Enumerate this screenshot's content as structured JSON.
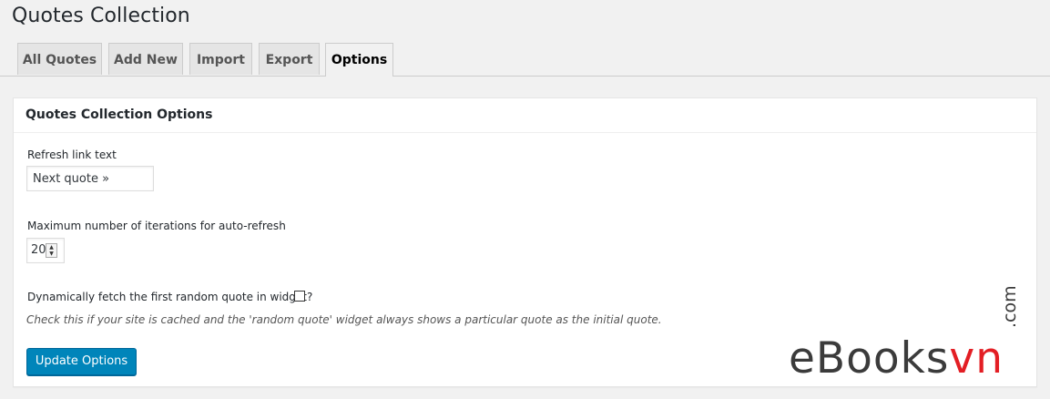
{
  "page": {
    "title": "Quotes Collection"
  },
  "tabs": [
    {
      "label": "All Quotes",
      "active": false
    },
    {
      "label": "Add New",
      "active": false
    },
    {
      "label": "Import",
      "active": false
    },
    {
      "label": "Export",
      "active": false
    },
    {
      "label": "Options",
      "active": true
    }
  ],
  "panel": {
    "title": "Quotes Collection Options",
    "refresh_label": "Refresh link text",
    "refresh_value": "Next quote »",
    "iterations_label": "Maximum number of iterations for auto-refresh",
    "iterations_value": "20",
    "dynamic_fetch_label": "Dynamically fetch the first random quote in widget?",
    "dynamic_fetch_checked": false,
    "dynamic_fetch_hint": "Check this if your site is cached and the 'random quote' widget always shows a particular quote as the initial quote.",
    "submit_label": "Update Options"
  },
  "watermark": {
    "brand_main": "eBooks",
    "brand_accent": "vn",
    "brand_suffix": ".com"
  },
  "colors": {
    "primary_button": "#0085ba",
    "watermark_accent": "#e31e24"
  }
}
